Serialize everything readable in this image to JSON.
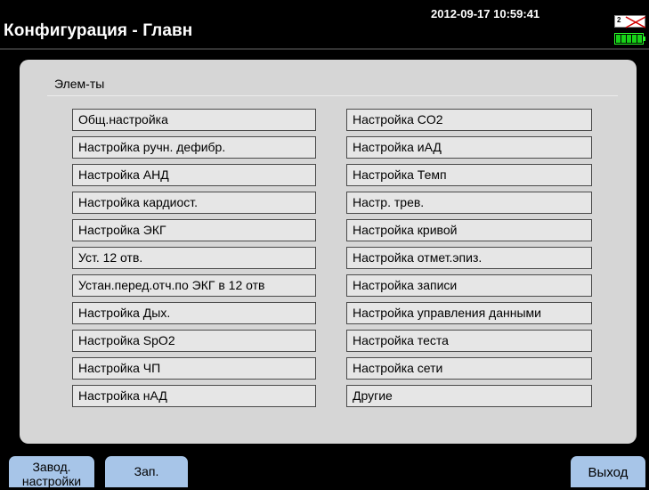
{
  "header": {
    "title": "Конфигурация - Главн",
    "datetime": "2012-09-17 10:59:41",
    "status_number": "2",
    "battery_color": "#17d117"
  },
  "panel": {
    "section_label": "Элем-ты",
    "left_items": [
      "Общ.настройка",
      "Настройка ручн. дефибр.",
      "Настройка АНД",
      "Настройка кардиост.",
      "Настройка ЭКГ",
      "Уст. 12 отв.",
      "Устан.перед.отч.по ЭКГ в 12 отв",
      "Настройка Дых.",
      "Настройка SpO2",
      "Настройка ЧП",
      "Настройка нАД"
    ],
    "right_items": [
      "Настройка CO2",
      "Настройка иАД",
      "Настройка Темп",
      "Настр. трев.",
      "Настройка кривой",
      "Настройка отмет.эпиз.",
      "Настройка записи",
      "Настройка управления данными",
      "Настройка теста",
      "Настройка сети",
      "Другие"
    ]
  },
  "bottom": {
    "factory_label_line1": "Завод.",
    "factory_label_line2": "настройки",
    "save_label": "Зап.",
    "exit_label": "Выход"
  },
  "colors": {
    "panel_bg": "#d6d6d6",
    "button_bg": "#a7c5e8"
  }
}
